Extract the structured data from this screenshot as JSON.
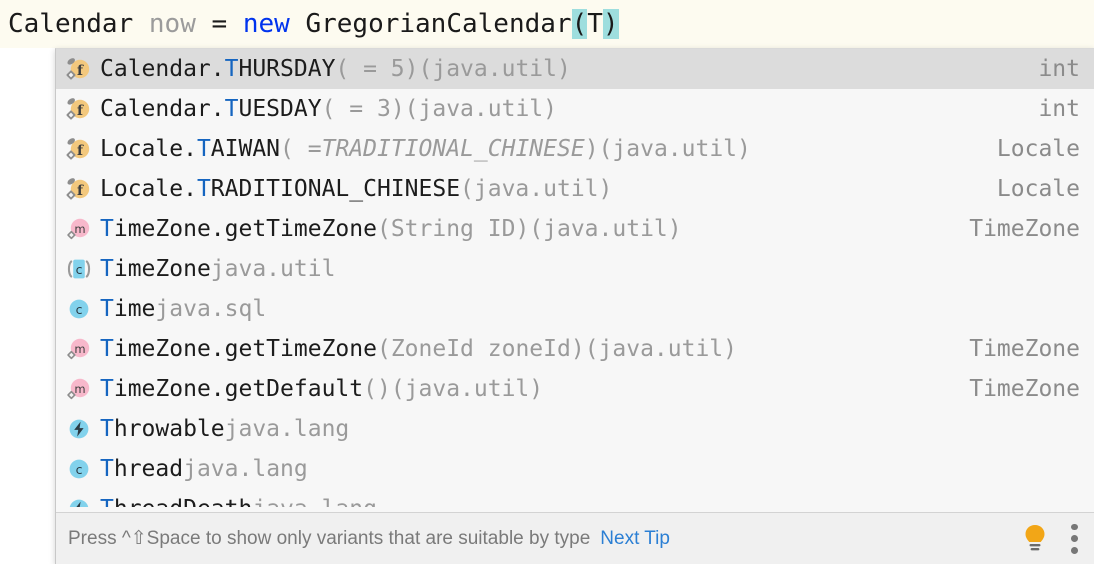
{
  "editor": {
    "tokens": [
      {
        "text": "Calendar ",
        "style": "plain"
      },
      {
        "text": "now",
        "style": "dim"
      },
      {
        "text": " = ",
        "style": "plain"
      },
      {
        "text": "new",
        "style": "keyword"
      },
      {
        "text": " GregorianCalendar",
        "style": "plain"
      },
      {
        "text": "(",
        "style": "highlight"
      },
      {
        "text": "T",
        "style": "plain"
      },
      {
        "text": ")",
        "style": "highlight"
      }
    ],
    "full_text": "Calendar now = new GregorianCalendar(T)",
    "has_error_squiggle": true
  },
  "completion": {
    "prefix": "T",
    "selected_index": 0,
    "items": [
      {
        "icon": "static-field-icon",
        "qualifier": "Calendar.",
        "match": "T",
        "name_rest": "HURSDAY",
        "tail": " ( = 5)",
        "tail_italic": "",
        "package": " (java.util)",
        "type": "int"
      },
      {
        "icon": "static-field-icon",
        "qualifier": "Calendar.",
        "match": "T",
        "name_rest": "UESDAY",
        "tail": " ( = 3)",
        "tail_italic": "",
        "package": " (java.util)",
        "type": "int"
      },
      {
        "icon": "static-field-icon",
        "qualifier": "Locale.",
        "match": "T",
        "name_rest": "AIWAN",
        "tail": " ( = ",
        "tail_italic": "TRADITIONAL_CHINESE",
        "tail_close": ")",
        "package": " (java.util)",
        "type": "Locale"
      },
      {
        "icon": "static-field-icon",
        "qualifier": "Locale.",
        "match": "T",
        "name_rest": "RADITIONAL_CHINESE",
        "tail": "",
        "tail_italic": "",
        "package": " (java.util)",
        "type": "Locale"
      },
      {
        "icon": "static-method-icon",
        "qualifier": "",
        "match": "T",
        "name_rest": "imeZone.getTimeZone",
        "tail": "(String ID)",
        "tail_italic": "",
        "package": " (java.util)",
        "type": "TimeZone"
      },
      {
        "icon": "abstract-class-icon",
        "qualifier": "",
        "match": "T",
        "name_rest": "imeZone",
        "tail": "",
        "tail_italic": "",
        "package": " java.util",
        "type": ""
      },
      {
        "icon": "class-icon",
        "qualifier": "",
        "match": "T",
        "name_rest": "ime",
        "tail": "",
        "tail_italic": "",
        "package": " java.sql",
        "type": ""
      },
      {
        "icon": "static-method-icon",
        "qualifier": "",
        "match": "T",
        "name_rest": "imeZone.getTimeZone",
        "tail": "(ZoneId zoneId)",
        "tail_italic": "",
        "package": " (java.util)",
        "type": "TimeZone"
      },
      {
        "icon": "static-method-icon",
        "qualifier": "",
        "match": "T",
        "name_rest": "imeZone.getDefault",
        "tail": "()",
        "tail_italic": "",
        "package": " (java.util)",
        "type": "TimeZone"
      },
      {
        "icon": "exception-class-icon",
        "qualifier": "",
        "match": "T",
        "name_rest": "hrowable",
        "tail": "",
        "tail_italic": "",
        "package": " java.lang",
        "type": ""
      },
      {
        "icon": "class-icon",
        "qualifier": "",
        "match": "T",
        "name_rest": "hread",
        "tail": "",
        "tail_italic": "",
        "package": " java.lang",
        "type": ""
      },
      {
        "icon": "exception-class-icon",
        "qualifier": "",
        "match": "T",
        "name_rest": "hreadDeath",
        "tail": "",
        "tail_italic": "",
        "package": " java.lang",
        "type": ""
      }
    ]
  },
  "statusbar": {
    "tip": "Press ^⇧Space to show only variants that are suitable by type",
    "next_tip": "Next Tip",
    "bulb_icon": "lightbulb-icon",
    "menu_icon": "kebab-menu-icon"
  },
  "colors": {
    "editor_bg": "#fdfbf0",
    "popup_bg": "#f7f7f7",
    "selected_row": "#dcdcdc",
    "match_blue": "#1565c0",
    "keyword_blue": "#0033ee",
    "paren_highlight": "#9edede",
    "link_blue": "#2b7fd4",
    "bulb_amber": "#f2a617",
    "field_orange": "#f0c477",
    "method_pink": "#f5b8c8",
    "class_blue": "#7fd4ee"
  }
}
